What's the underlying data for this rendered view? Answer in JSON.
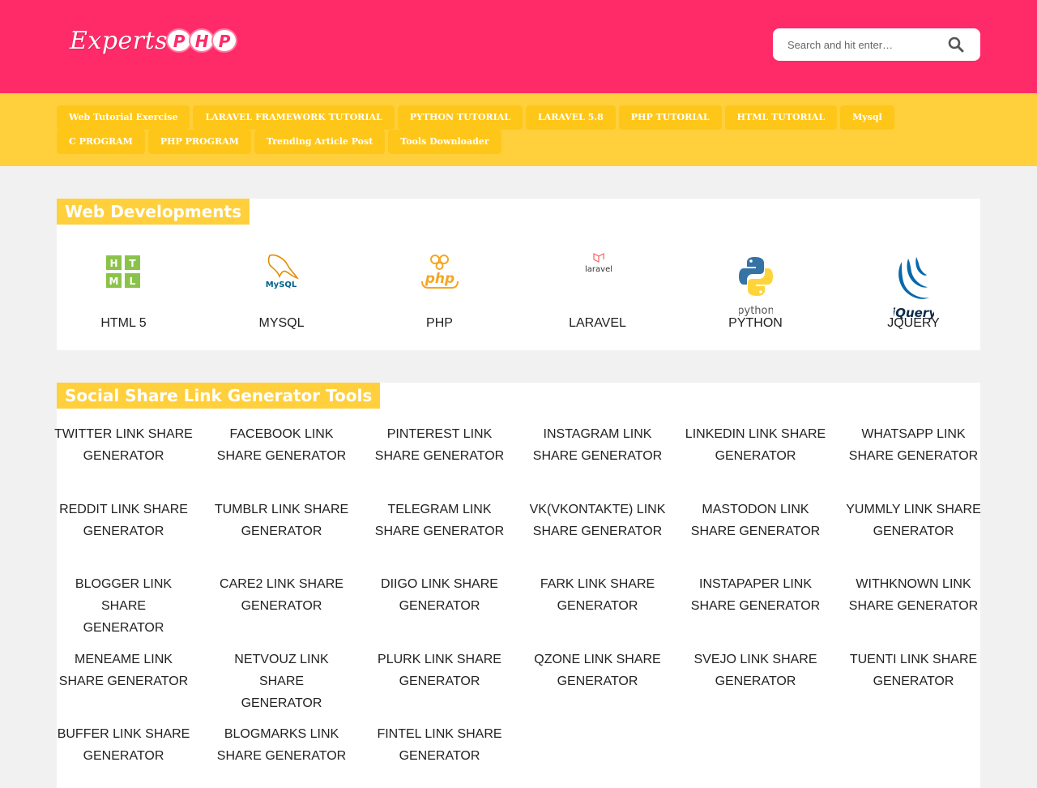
{
  "logo": {
    "word": "Experts",
    "letters": [
      "P",
      "H",
      "P"
    ]
  },
  "search": {
    "placeholder": "Search and hit enter…",
    "icon": "search-icon"
  },
  "nav": {
    "items": [
      "Web Tutorial Exercise",
      "LARAVEL FRAMEWORK TUTORIAL",
      "PYTHON TUTORIAL",
      "LARAVEL 5.8",
      "PHP TUTORIAL",
      "HTML TUTORIAL",
      "Mysql",
      "C PROGRAM",
      "PHP PROGRAM",
      "Trending Article Post",
      "Tools Downloader"
    ]
  },
  "web": {
    "title": "Web Developments",
    "items": [
      {
        "label": "HTML 5",
        "icon": "html5-icon",
        "logo_letters": [
          "H",
          "T",
          "M",
          "L"
        ]
      },
      {
        "label": "MYSQL",
        "icon": "mysql-icon",
        "logo_text": "MySQL"
      },
      {
        "label": "PHP",
        "icon": "php-icon",
        "logo_text": "php"
      },
      {
        "label": "LARAVEL",
        "icon": "laravel-icon",
        "logo_text": "laravel"
      },
      {
        "label": "PYTHON",
        "icon": "python-icon",
        "logo_text": "python"
      },
      {
        "label": "JQUERY",
        "icon": "jquery-icon",
        "logo_text": "jQuery"
      }
    ]
  },
  "social": {
    "title": "Social Share Link Generator Tools",
    "tools": [
      [
        "TWITTER LINK SHARE",
        "GENERATOR"
      ],
      [
        "FACEBOOK LINK",
        "SHARE GENERATOR"
      ],
      [
        "PINTEREST LINK",
        "SHARE GENERATOR"
      ],
      [
        "INSTAGRAM LINK",
        "SHARE GENERATOR"
      ],
      [
        "LINKEDIN LINK SHARE",
        "GENERATOR"
      ],
      [
        "WHATSAPP LINK",
        "SHARE GENERATOR"
      ],
      [
        "REDDIT LINK SHARE",
        "GENERATOR"
      ],
      [
        "TUMBLR LINK SHARE",
        "GENERATOR"
      ],
      [
        "TELEGRAM LINK",
        "SHARE GENERATOR"
      ],
      [
        "VK(VKONTAKTE) LINK",
        "SHARE GENERATOR"
      ],
      [
        "MASTODON LINK",
        "SHARE GENERATOR"
      ],
      [
        "YUMMLY LINK SHARE",
        "GENERATOR"
      ],
      [
        "BLOGGER LINK SHARE",
        "GENERATOR"
      ],
      [
        "CARE2 LINK SHARE",
        "GENERATOR"
      ],
      [
        "DIIGO LINK SHARE",
        "GENERATOR"
      ],
      [
        "FARK LINK SHARE",
        "GENERATOR"
      ],
      [
        "INSTAPAPER LINK",
        "SHARE GENERATOR"
      ],
      [
        "WITHKNOWN LINK",
        "SHARE GENERATOR"
      ],
      [
        "MENEAME LINK",
        "SHARE GENERATOR"
      ],
      [
        "NETVOUZ LINK SHARE",
        "GENERATOR"
      ],
      [
        "PLURK LINK SHARE",
        "GENERATOR"
      ],
      [
        "QZONE LINK SHARE",
        "GENERATOR"
      ],
      [
        "SVEJO LINK SHARE",
        "GENERATOR"
      ],
      [
        "TUENTI LINK SHARE",
        "GENERATOR"
      ],
      [
        "BUFFER LINK SHARE",
        "GENERATOR"
      ],
      [
        "BLOGMARKS LINK",
        "SHARE GENERATOR"
      ],
      [
        "FINTEL LINK SHARE",
        "GENERATOR"
      ]
    ]
  },
  "colors": {
    "header": "#ff2a68",
    "nav": "#ffd03c",
    "nav_item": "#ffc61a",
    "page": "#f1f1f1"
  }
}
